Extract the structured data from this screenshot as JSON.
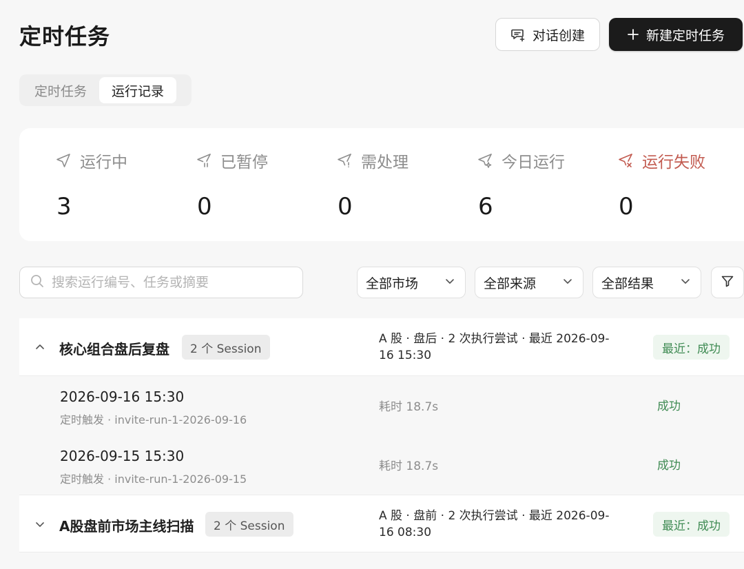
{
  "header": {
    "title": "定时任务",
    "chat_create_label": "对话创建",
    "new_task_label": "新建定时任务"
  },
  "tabs": [
    {
      "label": "定时任务",
      "active": false
    },
    {
      "label": "运行记录",
      "active": true
    }
  ],
  "stats": [
    {
      "label": "运行中",
      "value": "3",
      "icon": "send-icon"
    },
    {
      "label": "已暂停",
      "value": "0",
      "icon": "send-paused-icon"
    },
    {
      "label": "需处理",
      "value": "0",
      "icon": "send-alert-icon"
    },
    {
      "label": "今日运行",
      "value": "6",
      "icon": "send-sparkle-icon"
    },
    {
      "label": "运行失败",
      "value": "0",
      "icon": "send-error-icon",
      "color": "#c25a4f"
    }
  ],
  "filters": {
    "search_placeholder": "搜索运行编号、任务或摘要",
    "market": "全部市场",
    "source": "全部来源",
    "result": "全部结果"
  },
  "groups": [
    {
      "name": "核心组合盘后复盘",
      "session_badge": "2 个 Session",
      "meta": "A 股 · 盘后 · 2 次执行尝试 · 最近 2026-09-16 15:30",
      "latest": "最近：成功",
      "expanded": true,
      "runs": [
        {
          "time": "2026-09-16 15:30",
          "sub": "定时触发 · invite-run-1-2026-09-16",
          "duration": "耗时 18.7s",
          "status": "成功"
        },
        {
          "time": "2026-09-15 15:30",
          "sub": "定时触发 · invite-run-1-2026-09-15",
          "duration": "耗时 18.7s",
          "status": "成功"
        }
      ]
    },
    {
      "name": "A股盘前市场主线扫描",
      "session_badge": "2 个 Session",
      "meta": "A 股 · 盘前 · 2 次执行尝试 · 最近 2026-09-16 08:30",
      "latest": "最近：成功",
      "expanded": false,
      "runs": []
    }
  ],
  "colors": {
    "success": "#3f8b53",
    "danger": "#c25a4f",
    "primary_dark": "#1b1b1b"
  }
}
